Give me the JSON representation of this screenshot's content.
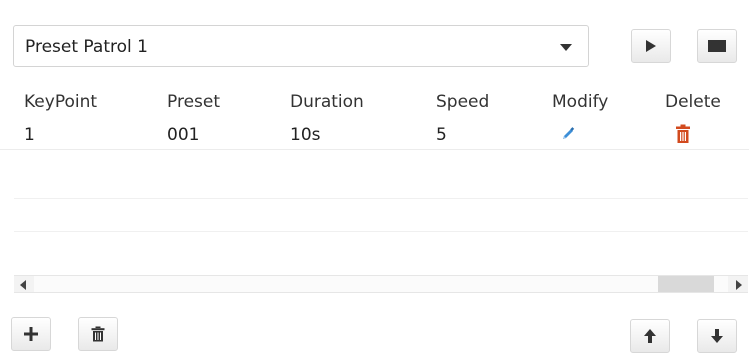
{
  "patrol": {
    "selected": "Preset Patrol 1"
  },
  "table": {
    "headers": [
      "KeyPoint",
      "Preset",
      "Duration",
      "Speed",
      "Modify",
      "Delete"
    ],
    "rows": [
      {
        "keypoint": "1",
        "preset": "001",
        "duration": "10s",
        "speed": "5"
      }
    ]
  },
  "icons": {
    "play": "play-icon",
    "stop": "stop-icon",
    "add": "plus-icon",
    "delete_all": "trash-icon",
    "move_up": "arrow-up-icon",
    "move_down": "arrow-down-icon",
    "modify": "pencil-icon",
    "delete": "trash-icon"
  },
  "colors": {
    "modify_icon": "#3d8fd8",
    "delete_icon": "#d24a1e",
    "toolbar_icon": "#333333"
  }
}
